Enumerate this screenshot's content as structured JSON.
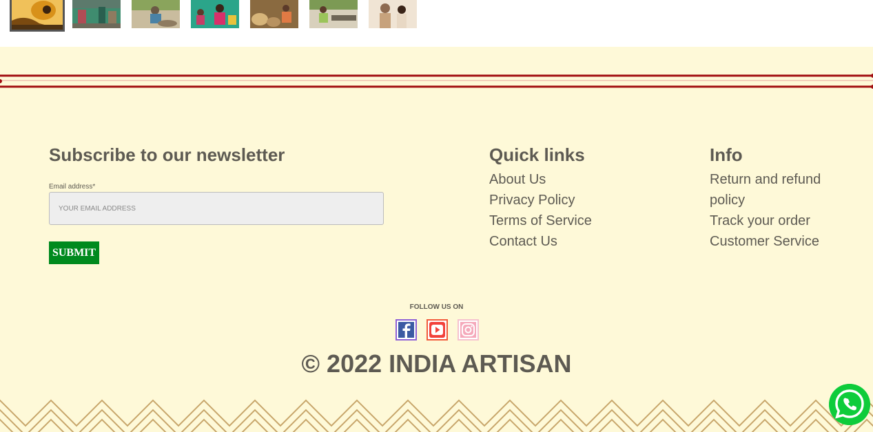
{
  "thumbnails": [
    {
      "name": "thumbnail-pottery",
      "active": true,
      "colors": [
        "#d8911a",
        "#7a4a10"
      ]
    },
    {
      "name": "thumbnail-workshop",
      "active": false,
      "colors": [
        "#3f8c6f",
        "#b04c55"
      ]
    },
    {
      "name": "thumbnail-potter-wheel",
      "active": false,
      "colors": [
        "#8aa45c",
        "#c9bc9e"
      ]
    },
    {
      "name": "thumbnail-artisans-group",
      "active": false,
      "colors": [
        "#2ba58a",
        "#c63e67"
      ]
    },
    {
      "name": "thumbnail-baskets",
      "active": false,
      "colors": [
        "#8a6a40",
        "#d7b57a"
      ]
    },
    {
      "name": "thumbnail-loom",
      "active": false,
      "colors": [
        "#7c9a54",
        "#d8d0bc"
      ]
    },
    {
      "name": "thumbnail-couple",
      "active": false,
      "colors": [
        "#c7a27c",
        "#f0e4d4"
      ]
    }
  ],
  "newsletter": {
    "title": "Subscribe to our newsletter",
    "email_label": "Email address*",
    "email_placeholder": "YOUR EMAIL ADDRESS",
    "email_value": "",
    "submit_label": "SUBMIT"
  },
  "quick_links": {
    "title": "Quick links",
    "items": [
      "About Us",
      "Privacy Policy",
      "Terms of Service",
      "Contact Us"
    ]
  },
  "info": {
    "title": "Info",
    "items": [
      "Return and refund policy",
      "Track your order",
      "Customer Service"
    ]
  },
  "social": {
    "follow_label": "FOLLOW US ON",
    "icons": [
      "facebook-icon",
      "youtube-icon",
      "instagram-icon"
    ]
  },
  "copyright": "© 2022 INDIA ARTISAN",
  "colors": {
    "footer_bg": "#fef9d8",
    "accent_red": "#a10d10",
    "submit_green": "#008a1e",
    "text_dark": "#5d5a52",
    "chevron_gold": "#c7a56a",
    "whatsapp_green": "#0ecc3b"
  }
}
